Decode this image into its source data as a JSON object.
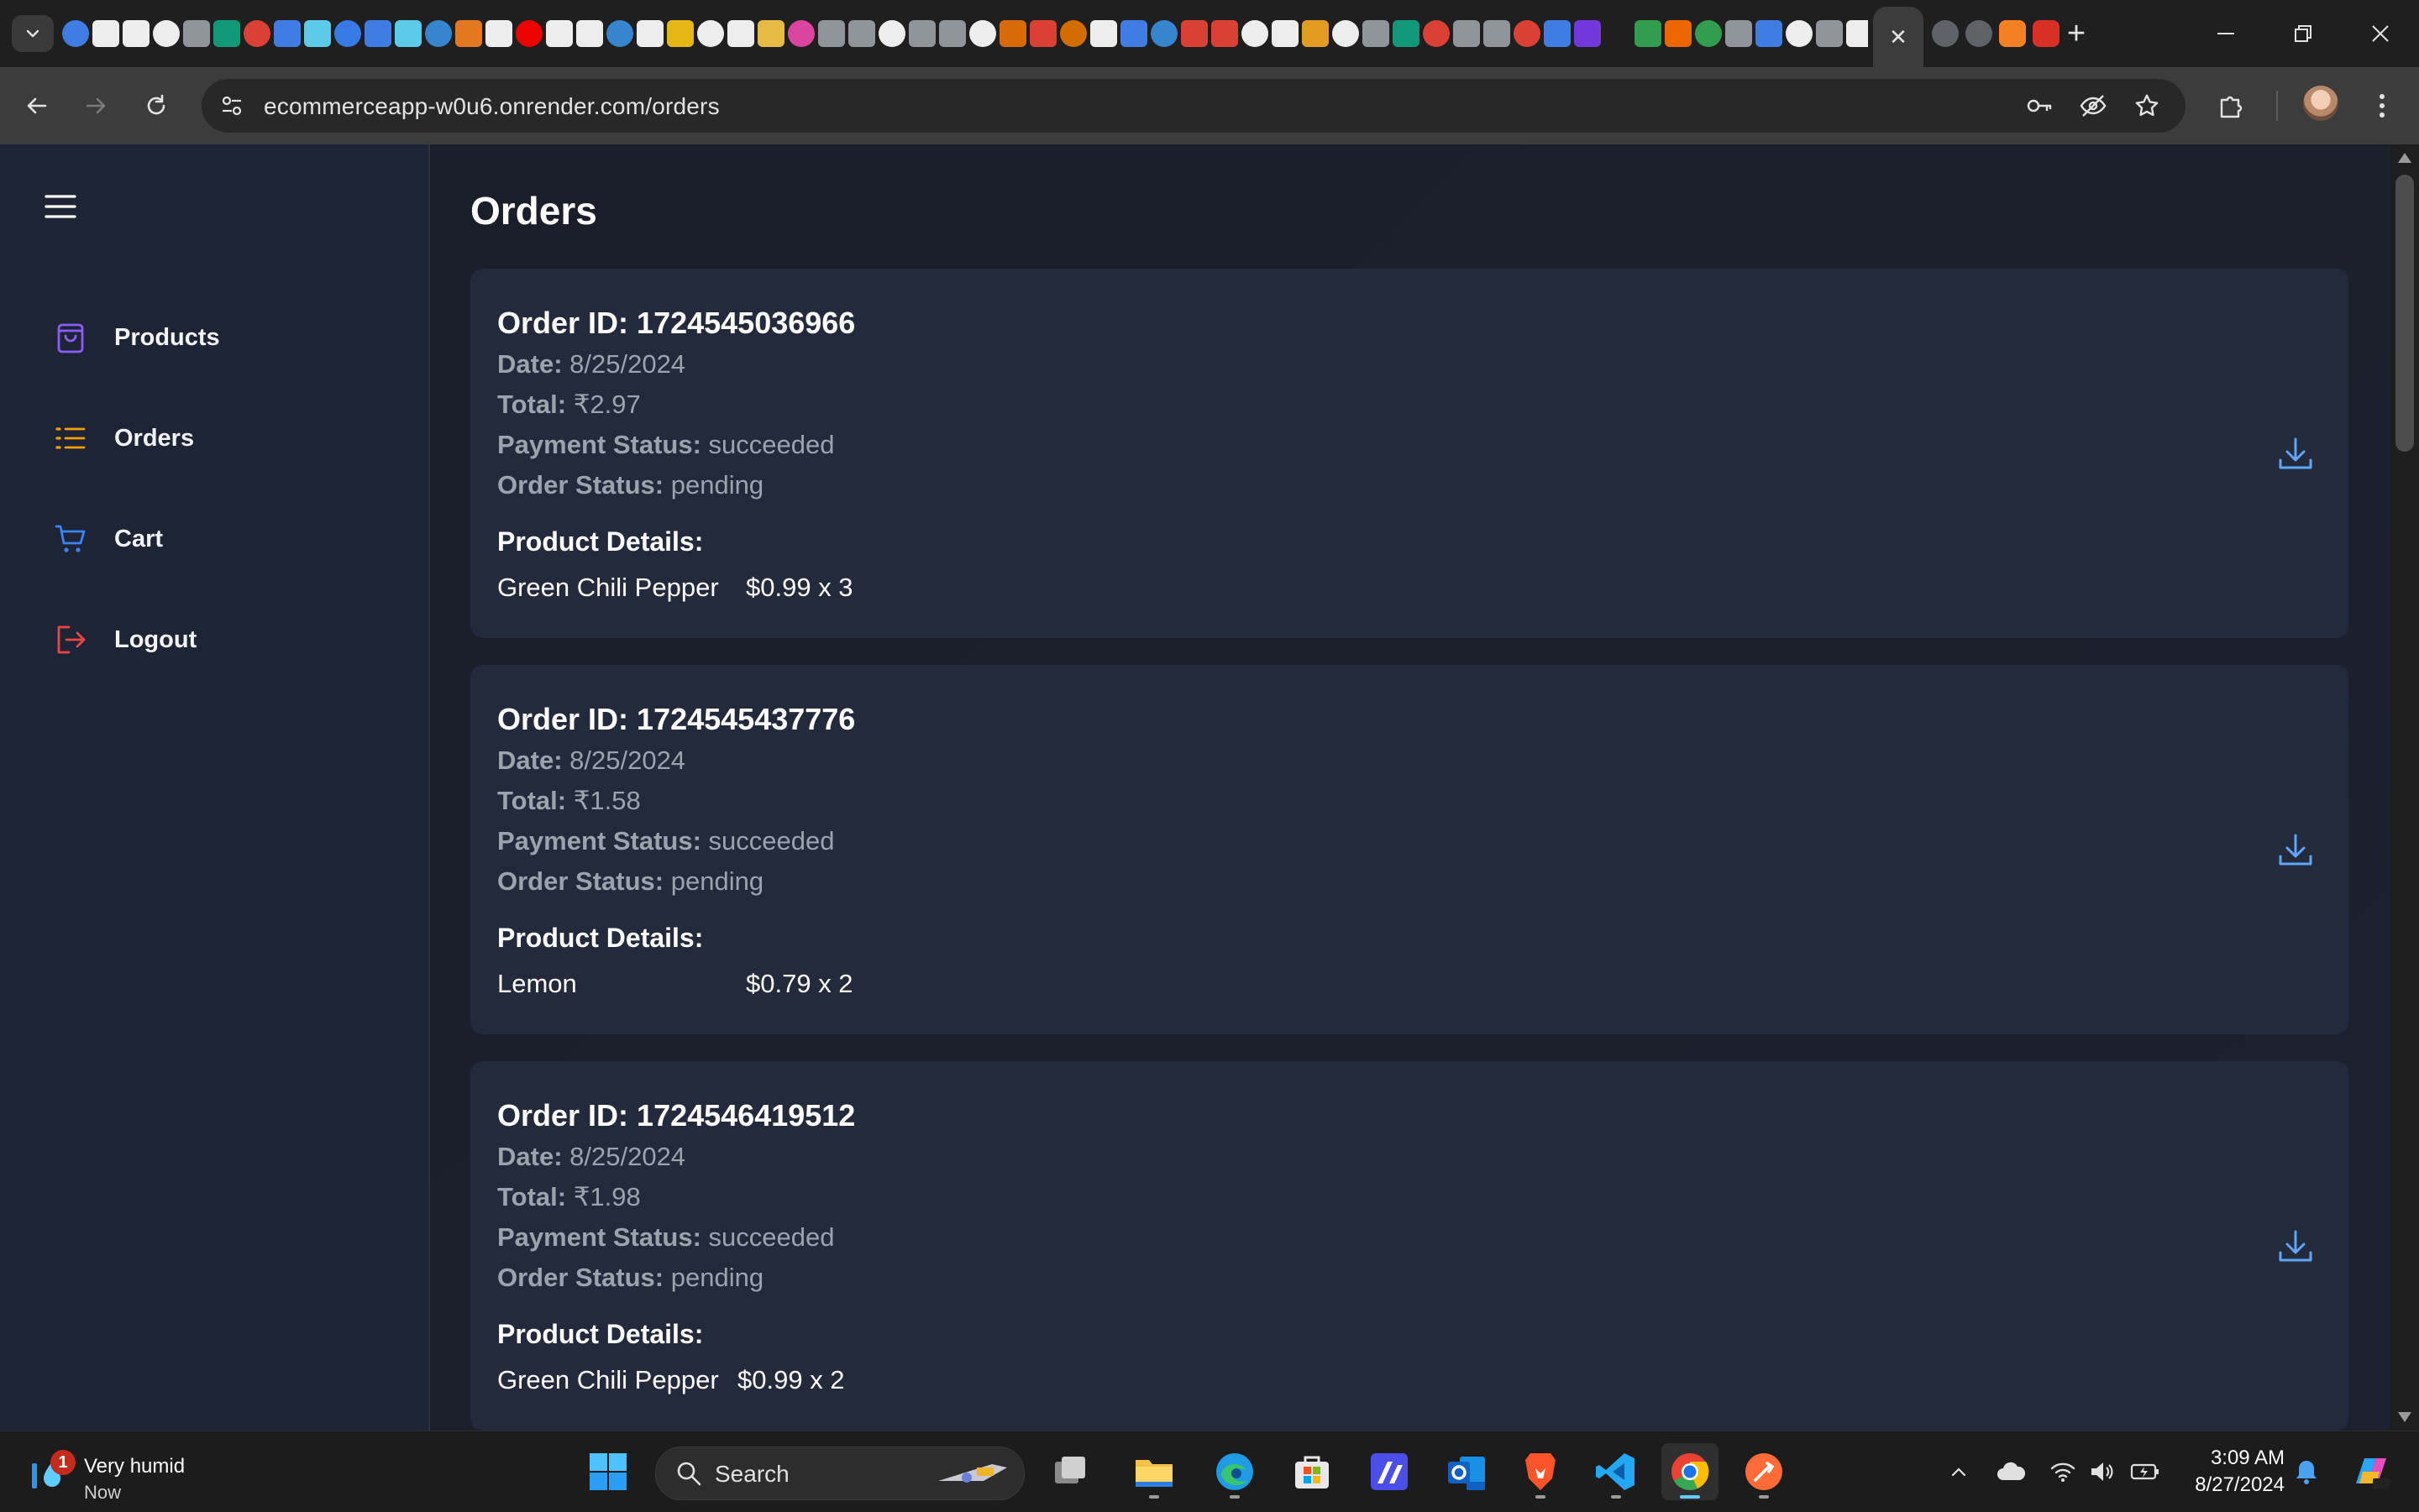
{
  "browser": {
    "url": "ecommerceapp-w0u6.onrender.com/orders",
    "tab_close_symbol": "✕",
    "new_tab_symbol": "+"
  },
  "sidebar": {
    "items": [
      {
        "label": "Products",
        "icon": "shopping-bag-icon",
        "color": "#8b5cf6"
      },
      {
        "label": "Orders",
        "icon": "list-icon",
        "color": "#f59e0b"
      },
      {
        "label": "Cart",
        "icon": "cart-icon",
        "color": "#3b82f6"
      },
      {
        "label": "Logout",
        "icon": "logout-icon",
        "color": "#ef4444"
      }
    ]
  },
  "page": {
    "title": "Orders"
  },
  "orders": [
    {
      "id_label": "Order ID:",
      "id": "1724545036966",
      "date_label": "Date:",
      "date": "8/25/2024",
      "total_label": "Total:",
      "total": "₹2.97",
      "payment_label": "Payment Status:",
      "payment_status": "succeeded",
      "order_status_label": "Order Status:",
      "order_status": "pending",
      "details_label": "Product Details:",
      "products": [
        {
          "name": "Green Chili Pepper",
          "price_qty": "$0.99 x 3"
        }
      ]
    },
    {
      "id_label": "Order ID:",
      "id": "1724545437776",
      "date_label": "Date:",
      "date": "8/25/2024",
      "total_label": "Total:",
      "total": "₹1.58",
      "payment_label": "Payment Status:",
      "payment_status": "succeeded",
      "order_status_label": "Order Status:",
      "order_status": "pending",
      "details_label": "Product Details:",
      "products": [
        {
          "name": "Lemon",
          "price_qty": "$0.79 x 2"
        }
      ]
    },
    {
      "id_label": "Order ID:",
      "id": "1724546419512",
      "date_label": "Date:",
      "date": "8/25/2024",
      "total_label": "Total:",
      "total": "₹1.98",
      "payment_label": "Payment Status:",
      "payment_status": "succeeded",
      "order_status_label": "Order Status:",
      "order_status": "pending",
      "details_label": "Product Details:",
      "products": [
        {
          "name": "Green Chili Pepper",
          "price_qty": "$0.99 x 2"
        }
      ]
    }
  ],
  "colors": {
    "accent": "#60a5fa",
    "sidebar_bg": "#1d2436",
    "card_bg": "#222a3c"
  },
  "taskbar": {
    "weather": {
      "title": "Very humid",
      "subtitle": "Now",
      "badge": "1"
    },
    "search_label": "Search",
    "time": "3:09 AM",
    "date": "8/27/2024"
  }
}
